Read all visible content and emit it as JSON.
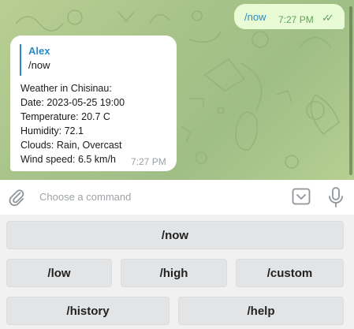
{
  "chat": {
    "outgoing": {
      "text": "/now",
      "time": "7:27 PM",
      "status_icon": "double-check-icon"
    },
    "incoming": {
      "reply_author": "Alex",
      "reply_text": "/now",
      "lines": [
        "Weather in Chisinau:",
        "Date: 2023-05-25 19:00",
        "Temperature: 20.7 C",
        "Humidity: 72.1",
        "Clouds: Rain, Overcast",
        "Wind speed: 6.5 km/h"
      ],
      "time": "7:27 PM"
    }
  },
  "input": {
    "placeholder": "Choose a command"
  },
  "keyboard": {
    "row1": [
      "/now"
    ],
    "row2": [
      "/low",
      "/high",
      "/custom"
    ],
    "row3": [
      "/history",
      "/help"
    ]
  },
  "colors": {
    "accent": "#2b8ac6",
    "outgoing_bubble": "#e8fbd5",
    "check": "#5fa35d",
    "chat_background": "#a9c48a"
  }
}
